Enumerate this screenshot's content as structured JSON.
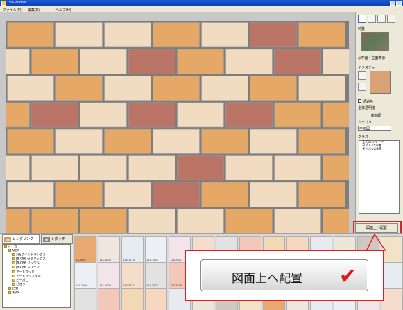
{
  "window": {
    "title": "3D-Painter"
  },
  "menu": [
    "ファイル(F)",
    "編集(E)",
    "ヘルプ(H)"
  ],
  "canvas": {
    "rows": [
      [
        "orange",
        "cream",
        "cream",
        "orange",
        "cream",
        "red",
        "orange"
      ],
      [
        "cream",
        "orange",
        "cream",
        "red",
        "orange",
        "cream",
        "red",
        "cream"
      ],
      [
        "cream",
        "orange",
        "cream",
        "orange",
        "cream",
        "orange",
        "cream"
      ],
      [
        "orange",
        "red",
        "cream",
        "red",
        "cream",
        "red",
        "orange",
        "orange"
      ],
      [
        "orange",
        "cream",
        "orange",
        "cream",
        "orange",
        "cream",
        "orange"
      ],
      [
        "cream",
        "cream",
        "cream",
        "cream",
        "red",
        "cream",
        "cream",
        "orange"
      ],
      [
        "cream",
        "orange",
        "cream",
        "red",
        "orange",
        "cream",
        "orange"
      ],
      [
        "orange",
        "orange",
        "orange",
        "cream",
        "cream",
        "orange",
        "cream",
        "orange"
      ]
    ],
    "colors": {
      "orange": "#e6a866",
      "cream": "#f1dcc1",
      "red": "#bb7567",
      "mortar": "#7d7d7d"
    }
  },
  "rightpanel": {
    "section1": "材質",
    "view_label": "◎平面・立面表示",
    "section2": "テクスチャ",
    "transparent_label": "透過色",
    "alpha_label": "全体透明度",
    "upper_label": "床面配",
    "category_label": "カテゴリ",
    "category_value": "平面図",
    "class_label": "クラス",
    "list_items": [
      "全てのレイヤー",
      "タイル1の3番",
      "タイル1の3番"
    ]
  },
  "place_button_small": "図面上へ配置",
  "bottom_tabs": [
    {
      "label": "レンダリング",
      "active": true
    },
    {
      "label": "レタッチ",
      "active": false
    }
  ],
  "tree": [
    "メーカー",
    "AICA",
    "3色ワイルドラングル",
    "JB-086 セラリックス",
    "JB-086 リッジル",
    "JB-086 レリーフ",
    "アートウッド",
    "アートクリスタル",
    "ピーパロ",
    "ピオラ",
    "EXD",
    "INAX"
  ],
  "swatch_captions": [
    "SA-8913",
    "124-1000",
    "124-1010",
    "124-1020",
    "124-2001",
    "124-2008",
    "124-2009",
    "124-3021",
    "124-3027",
    "124-3029"
  ],
  "callout": {
    "label": "図面上へ配置",
    "check": "✔"
  }
}
